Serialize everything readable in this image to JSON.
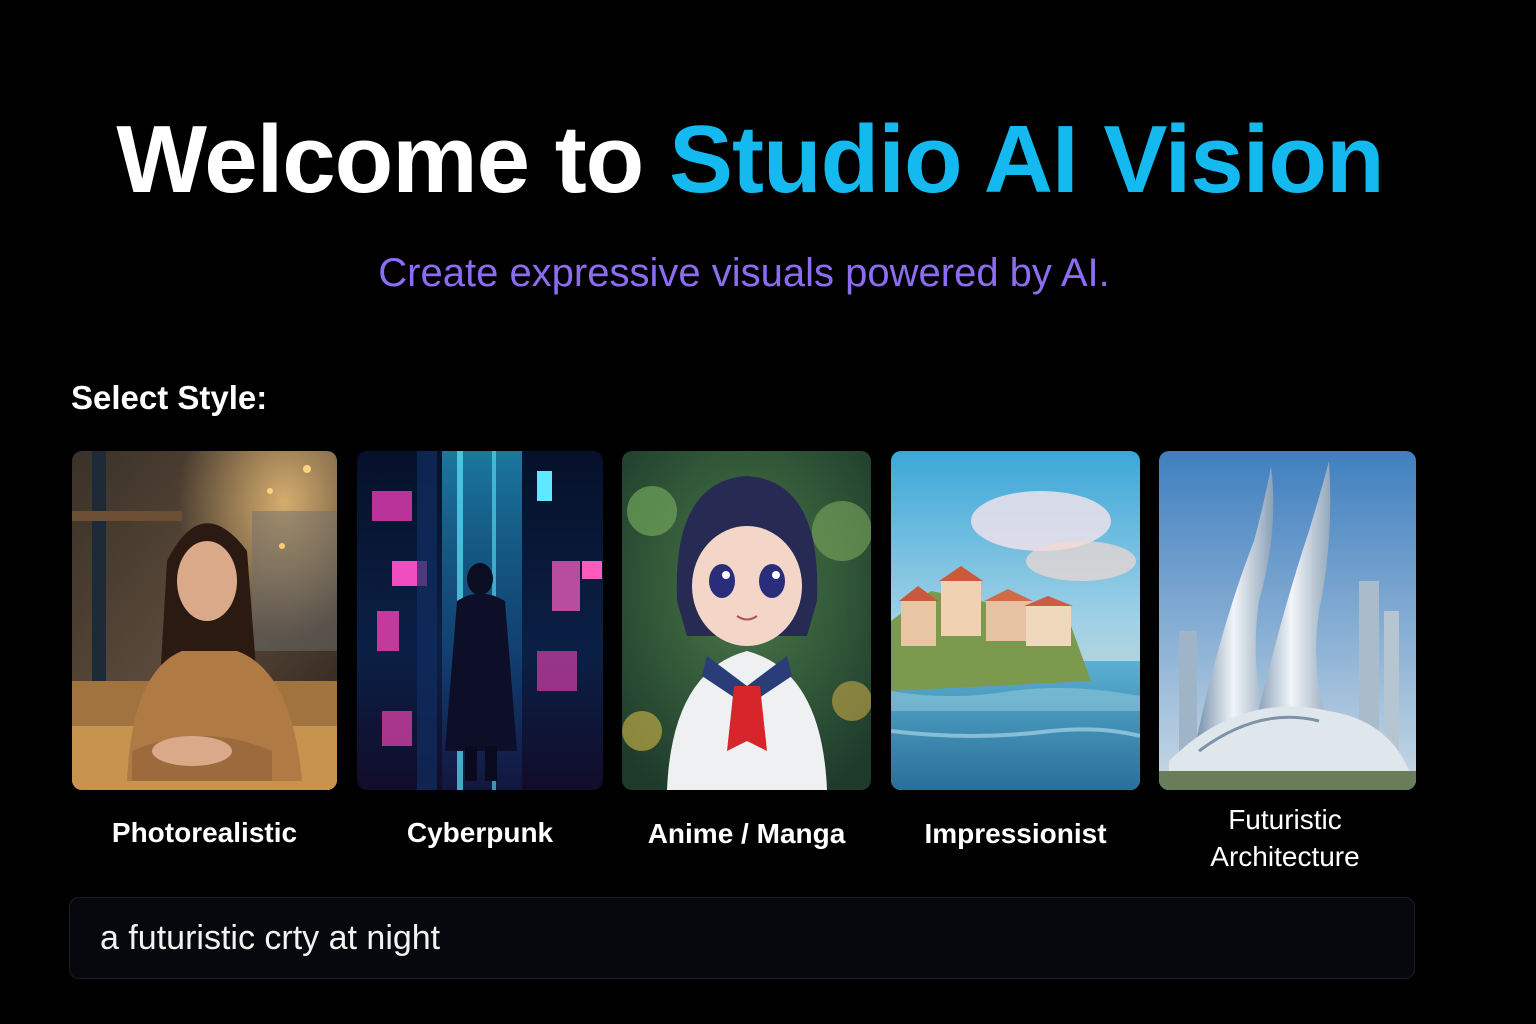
{
  "header": {
    "title_prefix": "Welcome to ",
    "title_accent": "Studio AI Vision",
    "subtitle": "Create expressive visuals powered by AI."
  },
  "styles_section": {
    "label": "Select Style:",
    "options": [
      {
        "label_line1": "Photorealistic",
        "label_line2": "",
        "icon": "photo-portrait-icon"
      },
      {
        "label_line1": "Cyberpunk",
        "label_line2": "",
        "icon": "neon-city-icon"
      },
      {
        "label_line1": "Anime / Manga",
        "label_line2": "",
        "icon": "anime-character-icon"
      },
      {
        "label_line1": "Impressionist",
        "label_line2": "",
        "icon": "painted-landscape-icon"
      },
      {
        "label_line1": "Futuristic",
        "label_line2": "Architecture",
        "icon": "futuristic-building-icon"
      }
    ]
  },
  "prompt": {
    "value": "a futuristic crty at night"
  },
  "colors": {
    "background": "#000000",
    "accent_cyan": "#13b9ef",
    "subtitle_purple": "#8c6cf0",
    "input_bg": "#07080d"
  }
}
